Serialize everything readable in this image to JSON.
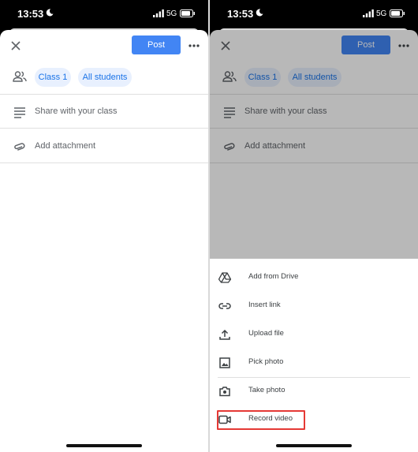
{
  "status_bar": {
    "time": "13:53",
    "network": "5G"
  },
  "composer": {
    "post_label": "Post",
    "audience_chips": [
      "Class 1",
      "All students"
    ],
    "share_placeholder": "Share with your class",
    "attachment_label": "Add attachment"
  },
  "attachment_menu": {
    "items": [
      {
        "label": "Add from Drive",
        "icon": "drive-icon"
      },
      {
        "label": "Insert link",
        "icon": "link-icon"
      },
      {
        "label": "Upload file",
        "icon": "upload-icon"
      },
      {
        "label": "Pick photo",
        "icon": "photo-icon"
      },
      {
        "label": "Take photo",
        "icon": "camera-icon"
      },
      {
        "label": "Record video",
        "icon": "video-icon"
      }
    ],
    "highlighted_item": "Record video"
  },
  "colors": {
    "primary": "#4285f4",
    "chip_bg": "#e8f0fe",
    "chip_text": "#1a73e8",
    "highlight": "#e53935"
  }
}
